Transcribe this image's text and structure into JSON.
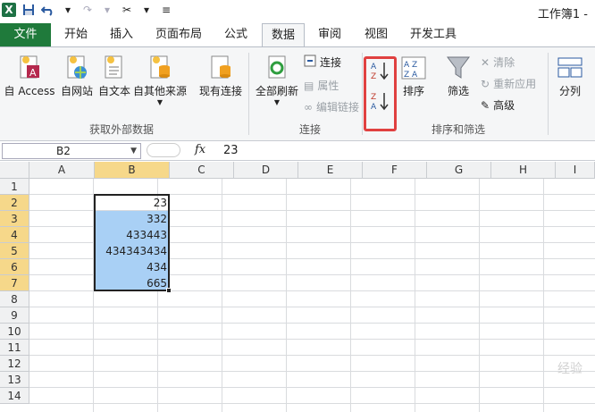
{
  "window": {
    "title": "工作簿1 -"
  },
  "qat": {
    "app_icon": "X",
    "save_icon": "save-icon",
    "undo_icon": "undo-icon",
    "redo_icon": "redo-icon",
    "tools_icon": "tools-icon",
    "customize_icon": "customize-icon"
  },
  "tabs": [
    {
      "label": "文件"
    },
    {
      "label": "开始"
    },
    {
      "label": "插入"
    },
    {
      "label": "页面布局"
    },
    {
      "label": "公式"
    },
    {
      "label": "数据"
    },
    {
      "label": "审阅"
    },
    {
      "label": "视图"
    },
    {
      "label": "开发工具"
    }
  ],
  "ribbon": {
    "get_external": {
      "label": "获取外部数据",
      "buttons": [
        "自 Access",
        "自网站",
        "自文本",
        "自其他来源"
      ]
    },
    "existing_connections": "现有连接",
    "connections": {
      "label": "连接",
      "refresh_all": "全部刷新",
      "connections": "连接",
      "properties": "属性",
      "edit_links": "编辑链接"
    },
    "sort_filter": {
      "label": "排序和筛选",
      "sort": "排序",
      "filter": "筛选",
      "clear": "清除",
      "reapply": "重新应用",
      "advanced": "高级"
    },
    "data_tools": {
      "split": "分列"
    }
  },
  "formula_bar": {
    "name_box": "B2",
    "fx": "fx",
    "value": "23"
  },
  "columns": [
    "A",
    "B",
    "C",
    "D",
    "E",
    "F",
    "G",
    "H",
    "I"
  ],
  "rows": [
    "1",
    "2",
    "3",
    "4",
    "5",
    "6",
    "7",
    "8",
    "9",
    "10",
    "11",
    "12",
    "13",
    "14"
  ],
  "cells": [
    "23",
    "332",
    "433443",
    "434343434",
    "434",
    "665"
  ],
  "watermark": "经验"
}
